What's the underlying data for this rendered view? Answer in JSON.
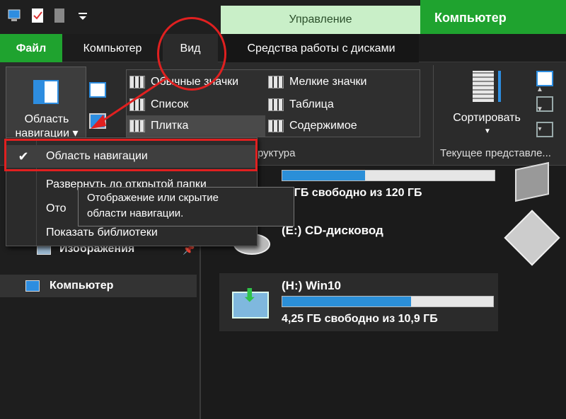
{
  "titlebar": {
    "context_label": "Управление",
    "window_title": "Компьютер"
  },
  "tabs": {
    "file": "Файл",
    "computer": "Компьютер",
    "view": "Вид",
    "disk_tools": "Средства работы с дисками"
  },
  "ribbon": {
    "nav_pane_label_line1": "Область",
    "nav_pane_label_line2": "навигации ▾",
    "layout": [
      "Обычные значки",
      "Мелкие значки",
      "Список",
      "Таблица",
      "Плитка",
      "Содержимое"
    ],
    "group_structure": "руктура",
    "sort_label": "Сортировать",
    "group_current_view": "Текущее представле..."
  },
  "menu": {
    "items": [
      "Область навигации",
      "Развернуть до открытой папки",
      "Ото",
      "Показать библиотеки"
    ]
  },
  "tooltip": {
    "line1": "Отображение или скрытие",
    "line2": "области навигации."
  },
  "navpane": {
    "images": "Изображения",
    "computer": "Компьютер"
  },
  "content": {
    "drive1_free": ",6 ГБ свободно из 120 ГБ",
    "drive1_used_fraction": 0.39,
    "cd_drive": "(E:) CD-дисковод",
    "win10_title": "(H:) Win10",
    "win10_free": "4,25 ГБ свободно из 10,9 ГБ",
    "win10_used_fraction": 0.61
  }
}
